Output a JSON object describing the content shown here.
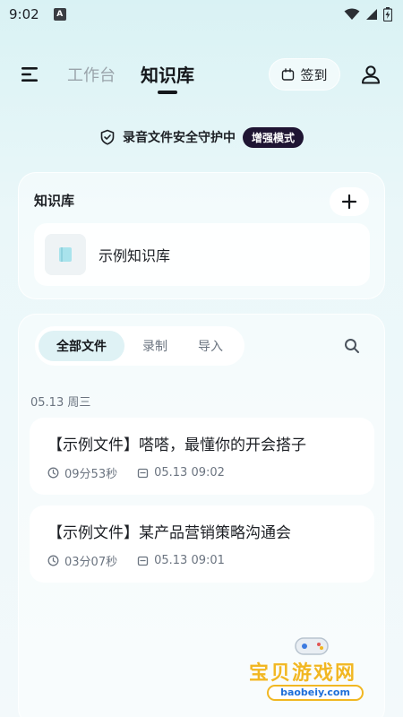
{
  "status_bar": {
    "time": "9:02",
    "notification_letter": "A",
    "icons": [
      "wifi-icon",
      "cellular-icon",
      "battery-icon"
    ]
  },
  "header": {
    "tabs": [
      {
        "label": "工作台",
        "active": false
      },
      {
        "label": "知识库",
        "active": true
      }
    ],
    "checkin_label": "签到",
    "menu_icon": "menu-icon",
    "profile_icon": "user-icon"
  },
  "security": {
    "text": "录音文件安全守护中",
    "badge": "增强模式",
    "icon": "shield-icon"
  },
  "knowledge_base": {
    "title": "知识库",
    "add_icon": "plus-icon",
    "items": [
      {
        "name": "示例知识库",
        "icon": "book-icon"
      }
    ]
  },
  "files": {
    "filters": [
      {
        "label": "全部文件",
        "active": true
      },
      {
        "label": "录制",
        "active": false
      },
      {
        "label": "导入",
        "active": false
      }
    ],
    "search_icon": "search-icon",
    "date_header": "05.13 周三",
    "items": [
      {
        "title": "【示例文件】嗒嗒，最懂你的开会搭子",
        "duration": "09分53秒",
        "datetime": "05.13 09:02"
      },
      {
        "title": "【示例文件】某产品营销策略沟通会",
        "duration": "03分07秒",
        "datetime": "05.13 09:01"
      }
    ]
  },
  "watermark": {
    "text": "宝贝游戏网",
    "url": "baobeiy.com"
  },
  "colors": {
    "accent_dark": "#1f1533",
    "active_filter_bg": "#dff2f5",
    "muted_text": "#6b7480",
    "inactive_tab": "#9aa4ab"
  }
}
